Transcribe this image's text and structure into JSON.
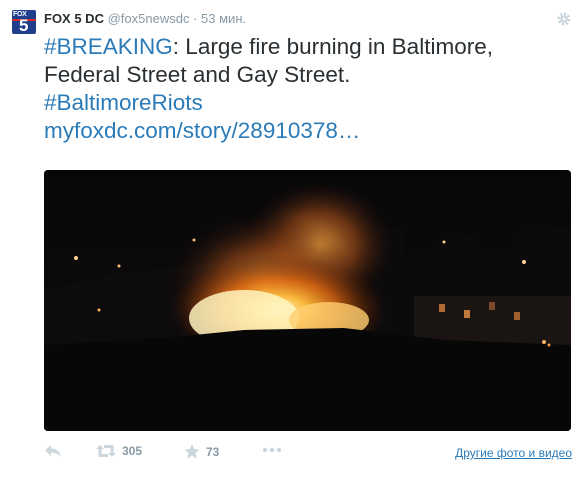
{
  "author": {
    "name": "FOX 5 DC",
    "handle": "@fox5newsdc",
    "separator": "·",
    "time": "53 мин.",
    "avatar_text_top": "FOX",
    "avatar_text_big": "5"
  },
  "tweet": {
    "hashtag_breaking": "#BREAKING",
    "text_line": ": Large fire burning in Baltimore, Federal Street and Gay Street.",
    "hashtag_riots": "#BaltimoreRiots",
    "link": "myfoxdc.com/story/28910378…"
  },
  "actions": {
    "retweet_count": "305",
    "favorite_count": "73",
    "more_media": "Другие фото и видео"
  },
  "colors": {
    "link": "#2b7bb9",
    "text": "#292f33",
    "muted": "#8899a6"
  },
  "icons": [
    "gear-icon",
    "reply-icon",
    "retweet-icon",
    "star-icon",
    "more-icon"
  ]
}
